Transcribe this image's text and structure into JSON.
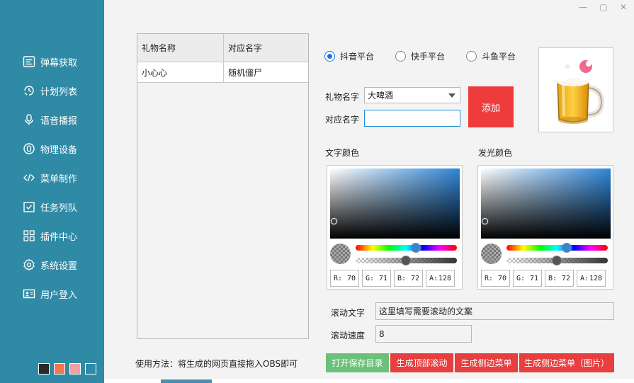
{
  "window": {
    "controls": [
      "—",
      "▢",
      "✕"
    ]
  },
  "sidebar": {
    "items": [
      {
        "label": "弹幕获取",
        "icon": "danmaku-list-icon"
      },
      {
        "label": "计划列表",
        "icon": "plan-cycle-icon"
      },
      {
        "label": "语音播报",
        "icon": "microphone-icon"
      },
      {
        "label": "物理设备",
        "icon": "device-icon"
      },
      {
        "label": "菜单制作",
        "icon": "code-icon"
      },
      {
        "label": "任务列队",
        "icon": "task-check-icon"
      },
      {
        "label": "插件中心",
        "icon": "plugin-grid-icon"
      },
      {
        "label": "系统设置",
        "icon": "gear-icon"
      },
      {
        "label": "用户登入",
        "icon": "user-card-icon"
      }
    ],
    "theme_swatches": [
      "#2a2a2a",
      "#f07850",
      "#f4a0a0",
      "#2f8aa6"
    ]
  },
  "table": {
    "headers": [
      "礼物名称",
      "对应名字"
    ],
    "rows": [
      [
        "小心心",
        "随机僵尸"
      ]
    ]
  },
  "usage_text": "使用方法：将生成的网页直接拖入OBS即可",
  "platforms": [
    {
      "label": "抖音平台",
      "selected": true
    },
    {
      "label": "快手平台",
      "selected": false
    },
    {
      "label": "斗鱼平台",
      "selected": false
    }
  ],
  "form": {
    "gift_label": "礼物名字",
    "gift_value": "大啤酒",
    "name_label": "对应名字",
    "name_value": "",
    "add_button": "添加"
  },
  "preview": {
    "icon": "beer-mug-icon"
  },
  "text_color": {
    "label": "文字颜色",
    "r": "70",
    "g": "71",
    "b": "72",
    "a": "128"
  },
  "glow_color": {
    "label": "发光颜色",
    "r": "70",
    "g": "71",
    "b": "72",
    "a": "128"
  },
  "scroll": {
    "text_label": "滚动文字",
    "text_value": "这里填写需要滚动的文案",
    "speed_label": "滚动速度",
    "speed_value": "8"
  },
  "buttons": {
    "open_dir": "打开保存目录",
    "gen_top": "生成顶部滚动",
    "gen_side": "生成侧边菜单",
    "gen_side_img": "生成侧边菜单（图片）"
  },
  "colors": {
    "sidebar": "#2f8aa6",
    "add_red": "#ee3c3c",
    "btn_green": "#6cc17a",
    "btn_red": "#e83e3e",
    "radio_blue": "#1e73d8"
  }
}
